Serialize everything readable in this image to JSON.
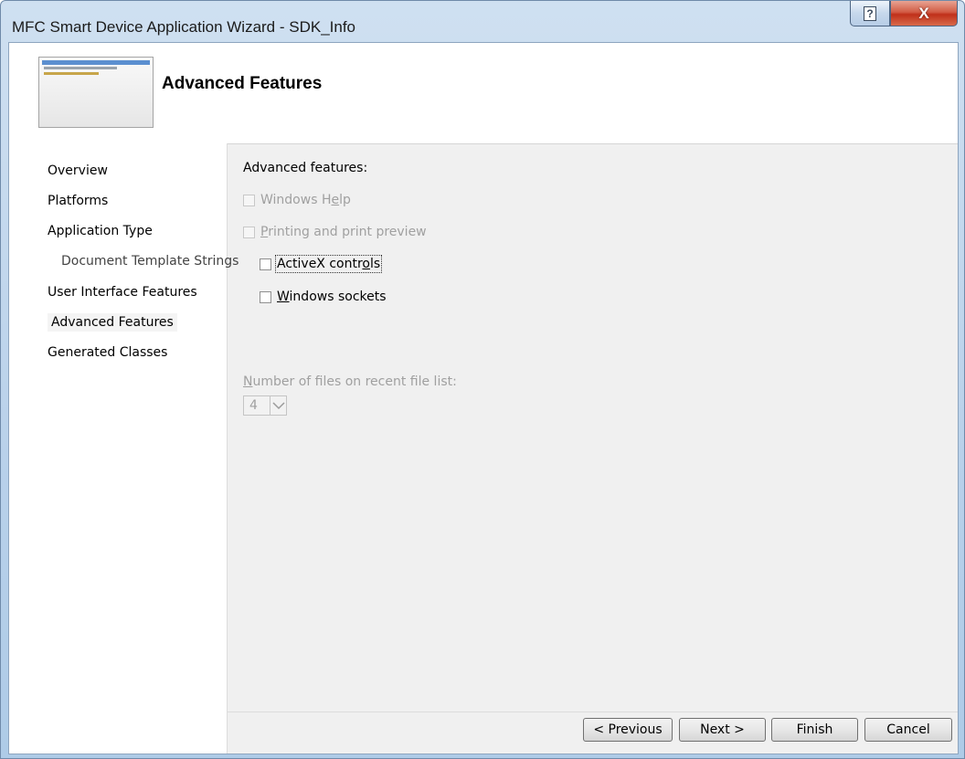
{
  "window": {
    "title": "MFC Smart Device Application Wizard - SDK_Info",
    "help_glyph": "?",
    "close_glyph": "X"
  },
  "header": {
    "title": "Advanced Features"
  },
  "nav": {
    "items": [
      {
        "label": "Overview",
        "indent": false
      },
      {
        "label": "Platforms",
        "indent": false
      },
      {
        "label": "Application Type",
        "indent": false
      },
      {
        "label": "Document Template Strings",
        "indent": true
      },
      {
        "label": "User Interface Features",
        "indent": false
      },
      {
        "label": "Advanced Features",
        "indent": false,
        "current": true
      },
      {
        "label": "Generated Classes",
        "indent": false
      }
    ]
  },
  "main": {
    "section_label": "Advanced features:",
    "options": [
      {
        "pre": "Windows H",
        "mnemonic": "e",
        "post": "lp",
        "checked": false,
        "enabled": false
      },
      {
        "pre": "",
        "mnemonic": "P",
        "post": "rinting and print preview",
        "checked": false,
        "enabled": false
      },
      {
        "pre": "ActiveX contr",
        "mnemonic": "o",
        "post": "ls",
        "checked": false,
        "enabled": true
      },
      {
        "pre": "",
        "mnemonic": "W",
        "post": "indows sockets",
        "checked": false,
        "enabled": true
      }
    ],
    "recent_files": {
      "label_mnemonic": "N",
      "label_rest": "umber of files on recent file list:",
      "value": "4",
      "enabled": false
    }
  },
  "buttons": {
    "previous": "< Previous",
    "next": "Next >",
    "finish": "Finish",
    "cancel": "Cancel"
  },
  "icons": [
    "help-icon",
    "close-icon",
    "app-window-preview-icon",
    "chevron-down-icon"
  ]
}
